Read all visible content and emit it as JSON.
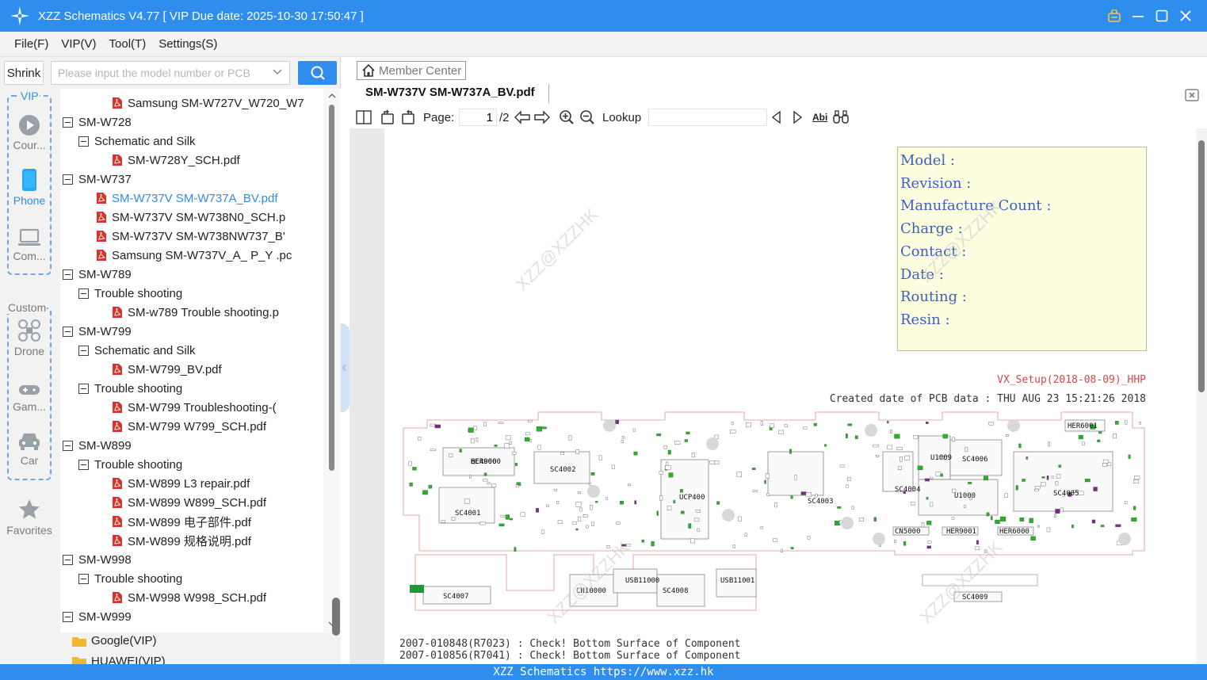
{
  "window": {
    "title": "XZZ Schematics V4.77 [ VIP Due date: 2025-10-30 17:50:47 ]",
    "controls": [
      "lock-icon",
      "minimize-icon",
      "maximize-icon",
      "close-icon"
    ]
  },
  "menu": [
    "File(F)",
    "VIP(V)",
    "Tool(T)",
    "Settings(S)"
  ],
  "left": {
    "shrink_label": "Shrink",
    "search_placeholder": "Please input the model number or PCB"
  },
  "nav": {
    "vip_label": "VIP",
    "vip_items": [
      {
        "label": "Cour...",
        "icon": "play-icon"
      },
      {
        "label": "Phone",
        "icon": "phone-icon"
      },
      {
        "label": "Com...",
        "icon": "laptop-icon"
      }
    ],
    "custom_label": "Custom",
    "custom_items": [
      {
        "label": "Drone",
        "icon": "drone-icon"
      },
      {
        "label": "Gam...",
        "icon": "gamepad-icon"
      },
      {
        "label": "Car",
        "icon": "car-icon"
      }
    ],
    "favorites_label": "Favorites"
  },
  "tree": [
    {
      "label": "Samsung SM-W727V_W720_W7",
      "type": "pdf",
      "level": 2
    },
    {
      "label": "SM-W728",
      "type": "node",
      "level": 0
    },
    {
      "label": "Schematic and Silk",
      "type": "node",
      "level": 1
    },
    {
      "label": "SM-W728Y_SCH.pdf",
      "type": "pdf",
      "level": 2
    },
    {
      "label": "SM-W737",
      "type": "node",
      "level": 0
    },
    {
      "label": "SM-W737V SM-W737A_BV.pdf",
      "type": "pdf",
      "level": 1,
      "selected": true
    },
    {
      "label": "SM-W737V SM-W738N0_SCH.p",
      "type": "pdf",
      "level": 1
    },
    {
      "label": "SM-W737V SM-W738NW737_B'",
      "type": "pdf",
      "level": 1
    },
    {
      "label": "Samsung SM-W737V_A_ P_Y .pc",
      "type": "pdf",
      "level": 1
    },
    {
      "label": "SM-W789",
      "type": "node",
      "level": 0
    },
    {
      "label": "Trouble shooting",
      "type": "node",
      "level": 1
    },
    {
      "label": "SM-w789 Trouble shooting.p",
      "type": "pdf",
      "level": 2
    },
    {
      "label": "SM-W799",
      "type": "node",
      "level": 0
    },
    {
      "label": "Schematic and Silk",
      "type": "node",
      "level": 1
    },
    {
      "label": "SM-W799_BV.pdf",
      "type": "pdf",
      "level": 2
    },
    {
      "label": "Trouble shooting",
      "type": "node",
      "level": 1
    },
    {
      "label": "SM-W799 Troubleshooting-(",
      "type": "pdf",
      "level": 2
    },
    {
      "label": "SM-W799 W799_SCH.pdf",
      "type": "pdf",
      "level": 2
    },
    {
      "label": "SM-W899",
      "type": "node",
      "level": 0
    },
    {
      "label": "Trouble shooting",
      "type": "node",
      "level": 1
    },
    {
      "label": "SM-W899 L3 repair.pdf",
      "type": "pdf",
      "level": 2
    },
    {
      "label": "SM-W899 W899_SCH.pdf",
      "type": "pdf",
      "level": 2
    },
    {
      "label": "SM-W899 电子部件.pdf",
      "type": "pdf",
      "level": 2
    },
    {
      "label": "SM-W899 规格说明.pdf",
      "type": "pdf",
      "level": 2
    },
    {
      "label": "SM-W998",
      "type": "node",
      "level": 0
    },
    {
      "label": "Trouble shooting",
      "type": "node",
      "level": 1
    },
    {
      "label": "SM-W998 W998_SCH.pdf",
      "type": "pdf",
      "level": 2
    },
    {
      "label": "SM-W999",
      "type": "node",
      "level": 0
    }
  ],
  "folders": [
    "Google(VIP)",
    "HUAWEI(VIP)"
  ],
  "right": {
    "member_center": "Member Center",
    "tab_title": "SM-W737V SM-W737A_BV.pdf",
    "page_label": "Page:",
    "page_value": "1",
    "page_total": "/2",
    "lookup_label": "Lookup",
    "abi_label": "Abi"
  },
  "document": {
    "info_labels": [
      "Model :",
      "Revision :",
      "Manufacture Count :",
      "Charge :",
      "Contact :",
      "Date :",
      "Routing :",
      "Resin :"
    ],
    "setup_line": "VX_Setup(2018-08-09)_HHP",
    "created_line": "Created date of PCB data : THU AUG 23 15:21:26 2018",
    "notes": [
      "2007-010848(R7023) : Check!  Bottom Surface of Component",
      "2007-010856(R7041) : Check!  Bottom Surface of Component"
    ],
    "watermark": "XZZ@XZZHK",
    "pcb_labels": [
      "SC4000",
      "SC4002",
      "SC4001",
      "UCP400",
      "SC4003",
      "SC4004",
      "U1009",
      "SC4006",
      "U1000",
      "SC4005",
      "SC4007",
      "CN10000",
      "USB11000",
      "SC4008",
      "USB11001",
      "SC4009",
      "CN5000",
      "HER9001",
      "HER6000",
      "HER6001",
      "HER9000"
    ]
  },
  "status_text": "XZZ Schematics https://www.xzz.hk",
  "colors": {
    "accent": "#2f8dee",
    "pdf_red": "#d9342b",
    "info_box": "#fdfde0"
  }
}
